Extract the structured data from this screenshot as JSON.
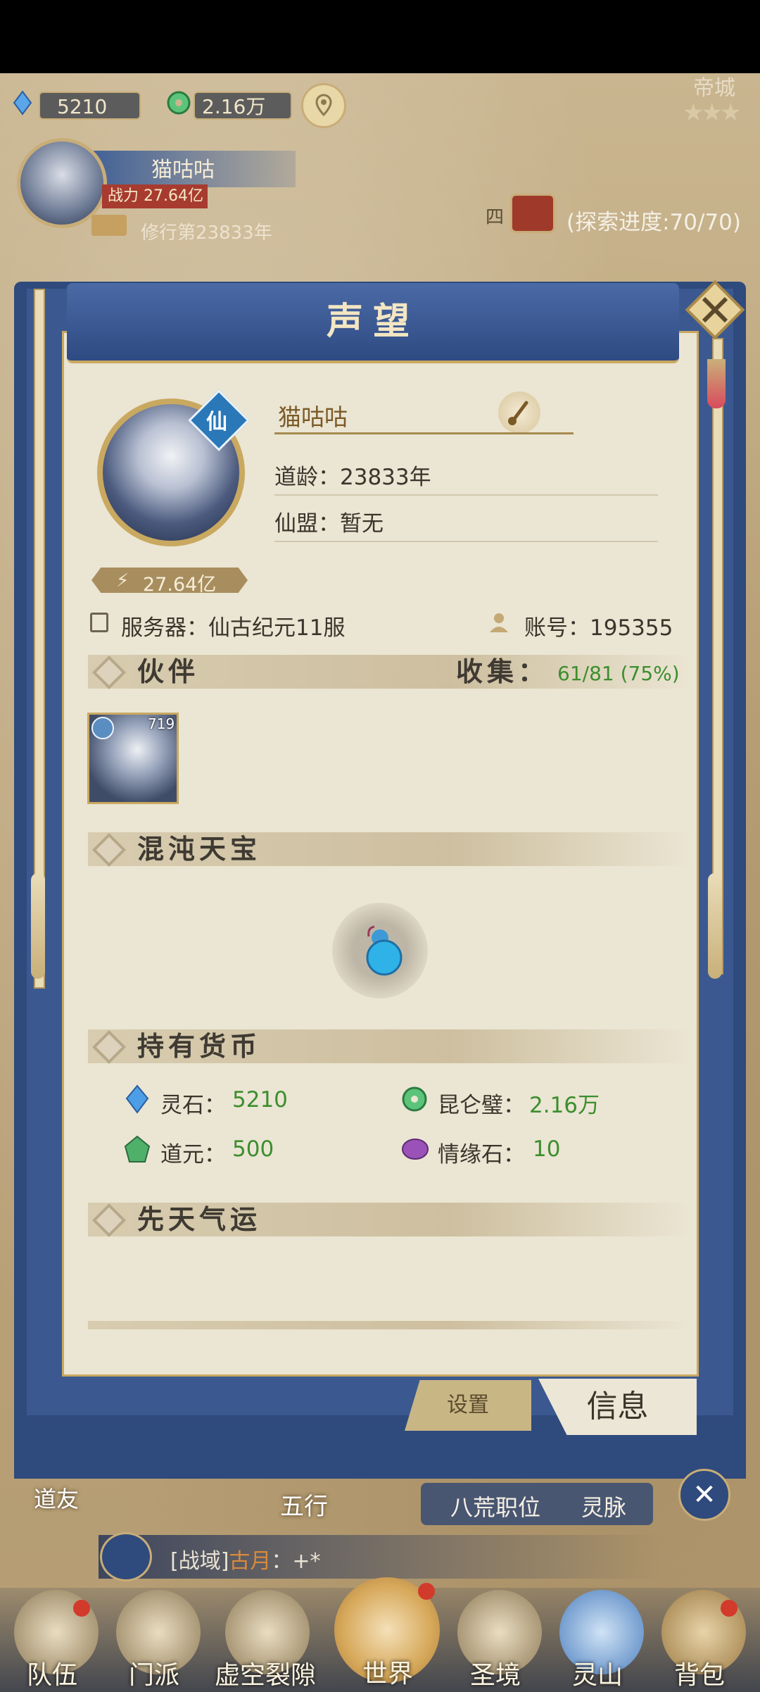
{
  "hud": {
    "spirit_stones": "5210",
    "kunlun_jade": "2.16万",
    "player_name": "猫咕咕",
    "power_label": "战力 27.64亿",
    "cultivation": "修行第23833年",
    "explore_progress": "(探索进度:70/70)",
    "map_label_left": "道友",
    "map_label_wuxing": "五行",
    "map_label_bahuang": "八荒职位",
    "map_label_lingmai": "灵脉",
    "city_label": "帝城",
    "map_label_four": "四"
  },
  "modal": {
    "title": "声望",
    "name": "猫咕咕",
    "xian_badge": "仙",
    "dao_age": "道龄：23833年",
    "alliance": "仙盟：暂无",
    "power": "27.64亿",
    "server": "服务器：仙古纪元11服",
    "account": "账号：195355",
    "companion_section": "伙伴",
    "collect_label": "收集：",
    "collect_value": "61/81 (75%)",
    "companion_level": "719",
    "treasure_section": "混沌天宝",
    "currency_section": "持有货币",
    "currencies": [
      {
        "label": "灵石：",
        "value": "5210"
      },
      {
        "label": "昆仑璧：",
        "value": "2.16万"
      },
      {
        "label": "道元：",
        "value": "500"
      },
      {
        "label": "情缘石：",
        "value": "10"
      }
    ],
    "fortune_section": "先天气运",
    "tab_settings": "设置",
    "tab_info": "信息"
  },
  "chat": {
    "channel": "[战域]",
    "speaker": "古月",
    "message": "：+*"
  },
  "bottom_nav": [
    "队伍",
    "门派",
    "虚空裂隙",
    "世界",
    "圣境",
    "灵山",
    "背包"
  ],
  "colors": {
    "accent": "#3b5990",
    "paper": "#ebe5d3",
    "gold": "#caa860",
    "green": "#3c8e2e"
  }
}
